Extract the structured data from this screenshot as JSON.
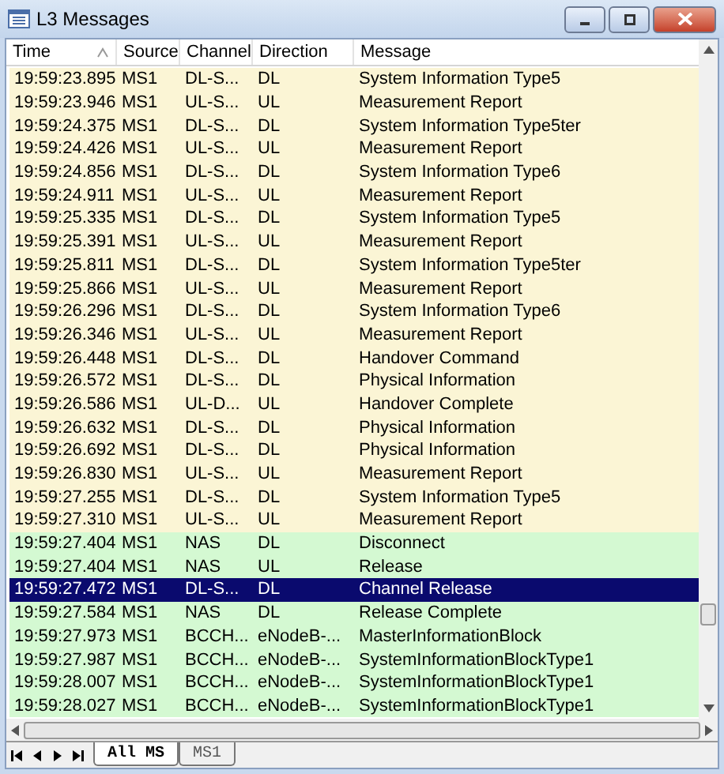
{
  "window": {
    "title": "L3 Messages"
  },
  "table": {
    "columns": [
      {
        "label": "Time",
        "sorted": true
      },
      {
        "label": "Source"
      },
      {
        "label": "Channel"
      },
      {
        "label": "Direction"
      },
      {
        "label": "Message"
      }
    ],
    "rows": [
      {
        "cells": [
          "19:59:23.895",
          "MS1",
          "DL-S...",
          "DL",
          "System Information Type5"
        ],
        "color": "#fbf5d5",
        "selected": false
      },
      {
        "cells": [
          "19:59:23.946",
          "MS1",
          "UL-S...",
          "UL",
          "Measurement Report"
        ],
        "color": "#fbf5d5",
        "selected": false
      },
      {
        "cells": [
          "19:59:24.375",
          "MS1",
          "DL-S...",
          "DL",
          "System Information Type5ter"
        ],
        "color": "#fbf5d5",
        "selected": false
      },
      {
        "cells": [
          "19:59:24.426",
          "MS1",
          "UL-S...",
          "UL",
          "Measurement Report"
        ],
        "color": "#fbf5d5",
        "selected": false
      },
      {
        "cells": [
          "19:59:24.856",
          "MS1",
          "DL-S...",
          "DL",
          "System Information Type6"
        ],
        "color": "#fbf5d5",
        "selected": false
      },
      {
        "cells": [
          "19:59:24.911",
          "MS1",
          "UL-S...",
          "UL",
          "Measurement Report"
        ],
        "color": "#fbf5d5",
        "selected": false
      },
      {
        "cells": [
          "19:59:25.335",
          "MS1",
          "DL-S...",
          "DL",
          "System Information Type5"
        ],
        "color": "#fbf5d5",
        "selected": false
      },
      {
        "cells": [
          "19:59:25.391",
          "MS1",
          "UL-S...",
          "UL",
          "Measurement Report"
        ],
        "color": "#fbf5d5",
        "selected": false
      },
      {
        "cells": [
          "19:59:25.811",
          "MS1",
          "DL-S...",
          "DL",
          "System Information Type5ter"
        ],
        "color": "#fbf5d5",
        "selected": false
      },
      {
        "cells": [
          "19:59:25.866",
          "MS1",
          "UL-S...",
          "UL",
          "Measurement Report"
        ],
        "color": "#fbf5d5",
        "selected": false
      },
      {
        "cells": [
          "19:59:26.296",
          "MS1",
          "DL-S...",
          "DL",
          "System Information Type6"
        ],
        "color": "#fbf5d5",
        "selected": false
      },
      {
        "cells": [
          "19:59:26.346",
          "MS1",
          "UL-S...",
          "UL",
          "Measurement Report"
        ],
        "color": "#fbf5d5",
        "selected": false
      },
      {
        "cells": [
          "19:59:26.448",
          "MS1",
          "DL-S...",
          "DL",
          "Handover Command"
        ],
        "color": "#fbf5d5",
        "selected": false
      },
      {
        "cells": [
          "19:59:26.572",
          "MS1",
          "DL-S...",
          "DL",
          "Physical Information"
        ],
        "color": "#fbf5d5",
        "selected": false
      },
      {
        "cells": [
          "19:59:26.586",
          "MS1",
          "UL-D...",
          "UL",
          "Handover Complete"
        ],
        "color": "#fbf5d5",
        "selected": false
      },
      {
        "cells": [
          "19:59:26.632",
          "MS1",
          "DL-S...",
          "DL",
          "Physical Information"
        ],
        "color": "#fbf5d5",
        "selected": false
      },
      {
        "cells": [
          "19:59:26.692",
          "MS1",
          "DL-S...",
          "DL",
          "Physical Information"
        ],
        "color": "#fbf5d5",
        "selected": false
      },
      {
        "cells": [
          "19:59:26.830",
          "MS1",
          "UL-S...",
          "UL",
          "Measurement Report"
        ],
        "color": "#fbf5d5",
        "selected": false
      },
      {
        "cells": [
          "19:59:27.255",
          "MS1",
          "DL-S...",
          "DL",
          "System Information Type5"
        ],
        "color": "#fbf5d5",
        "selected": false
      },
      {
        "cells": [
          "19:59:27.310",
          "MS1",
          "UL-S...",
          "UL",
          "Measurement Report"
        ],
        "color": "#fbf5d5",
        "selected": false
      },
      {
        "cells": [
          "19:59:27.404",
          "MS1",
          "NAS",
          "DL",
          "Disconnect"
        ],
        "color": "#d4f9d2",
        "selected": false
      },
      {
        "cells": [
          "19:59:27.404",
          "MS1",
          "NAS",
          "UL",
          "Release"
        ],
        "color": "#d4f9d2",
        "selected": false
      },
      {
        "cells": [
          "19:59:27.472",
          "MS1",
          "DL-S...",
          "DL",
          "Channel Release"
        ],
        "selected": true
      },
      {
        "cells": [
          "19:59:27.584",
          "MS1",
          "NAS",
          "DL",
          "Release Complete"
        ],
        "color": "#d4f9d2",
        "selected": false
      },
      {
        "cells": [
          "19:59:27.973",
          "MS1",
          "BCCH...",
          "eNodeB-...",
          "MasterInformationBlock"
        ],
        "color": "#d4f9d2",
        "selected": false
      },
      {
        "cells": [
          "19:59:27.987",
          "MS1",
          "BCCH...",
          "eNodeB-...",
          "SystemInformationBlockType1"
        ],
        "color": "#d4f9d2",
        "selected": false
      },
      {
        "cells": [
          "19:59:28.007",
          "MS1",
          "BCCH...",
          "eNodeB-...",
          "SystemInformationBlockType1"
        ],
        "color": "#d4f9d2",
        "selected": false
      },
      {
        "cells": [
          "19:59:28.027",
          "MS1",
          "BCCH...",
          "eNodeB-...",
          "SystemInformationBlockType1"
        ],
        "color": "#d4f9d2",
        "selected": false
      }
    ]
  },
  "sheet_tabs": [
    {
      "label": "All MS",
      "selected": true
    },
    {
      "label": "MS1",
      "selected": false
    }
  ]
}
